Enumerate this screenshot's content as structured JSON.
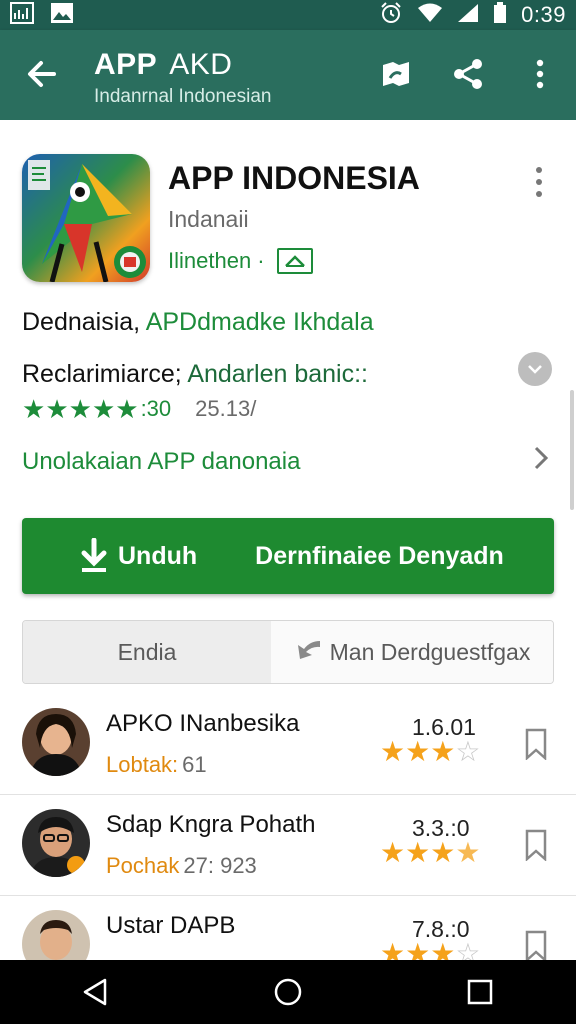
{
  "status_bar": {
    "time": "0:39",
    "icons": [
      "image-icon",
      "photo-icon",
      "alarm-icon",
      "wifi-icon",
      "signal-icon",
      "battery-icon"
    ]
  },
  "toolbar": {
    "title": "APP",
    "title_suffix": "AKD",
    "subtitle": "Indanrnal Indonesian",
    "icons": [
      "back-arrow-icon",
      "map-icon",
      "share-icon",
      "overflow-menu-icon"
    ]
  },
  "app": {
    "name": "APP INDONESIA",
    "developer": "Indanaii",
    "category": "Ilinethen ·",
    "description_line1_black": "Dednaisia, ",
    "description_line1_green": "APDdmadke Ikhdala",
    "description_line2_black": "Reclarimiarce; ",
    "description_line2_green": "Andarlen banic::",
    "rating": 5,
    "rating_count": ":30",
    "downloads": "25.13/",
    "more_link": "Unolakaian APP  danonaia"
  },
  "install_button": {
    "label": "Unduh",
    "secondary_label": "Dernfinaiee Denyadn"
  },
  "tabs": [
    {
      "label": "Endia",
      "active": true
    },
    {
      "label": "Man Derdguestfgax",
      "active": false
    }
  ],
  "reviews": [
    {
      "name": "APKO INanbesika",
      "meta_orange": "Lobtak:",
      "meta_gray": "61",
      "score": "1.6.01",
      "stars": 3
    },
    {
      "name": "Sdap Kngra Pohath",
      "meta_orange": "Pochak",
      "meta_gray": "27:  923",
      "score": "3.3.:0",
      "stars": 3.5
    },
    {
      "name": "Ustar DAPB",
      "meta_orange": "",
      "meta_gray": "",
      "score": "7.8.:0",
      "stars": 3
    }
  ],
  "colors": {
    "status_bar": "#1f5c50",
    "toolbar": "#2a6e5e",
    "accent_green": "#1d8c3a",
    "install_button": "#1e8a30",
    "star_orange": "#f5a21b"
  }
}
